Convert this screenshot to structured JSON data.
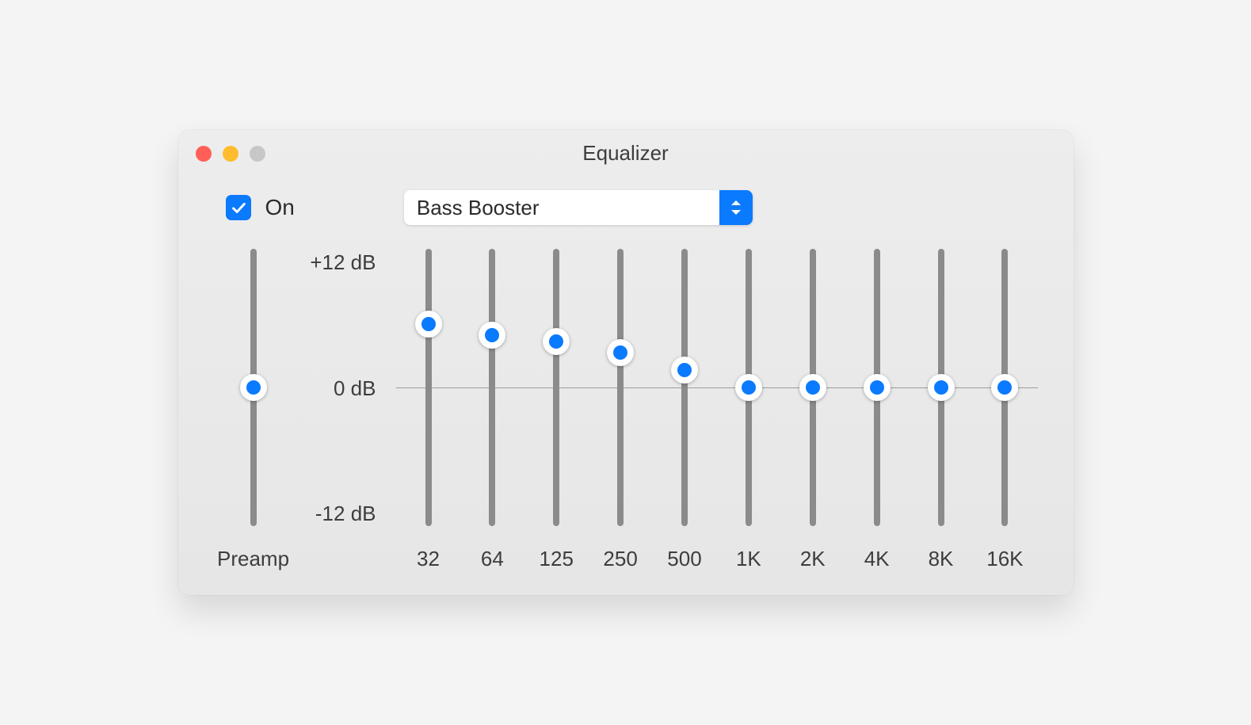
{
  "window": {
    "title": "Equalizer"
  },
  "controls": {
    "on_checked": true,
    "on_label": "On",
    "preset_value": "Bass Booster"
  },
  "scale": {
    "max": "+12 dB",
    "zero": "0 dB",
    "min": "-12 dB"
  },
  "preamp": {
    "label": "Preamp",
    "value_db": 0
  },
  "bands": [
    {
      "freq": "32",
      "value_db": 5.5
    },
    {
      "freq": "64",
      "value_db": 4.5
    },
    {
      "freq": "125",
      "value_db": 4.0
    },
    {
      "freq": "250",
      "value_db": 3.0
    },
    {
      "freq": "500",
      "value_db": 1.5
    },
    {
      "freq": "1K",
      "value_db": 0
    },
    {
      "freq": "2K",
      "value_db": 0
    },
    {
      "freq": "4K",
      "value_db": 0
    },
    {
      "freq": "8K",
      "value_db": 0
    },
    {
      "freq": "16K",
      "value_db": 0
    }
  ],
  "chart_data": {
    "type": "bar",
    "title": "Equalizer",
    "ylabel": "dB",
    "ylim": [
      -12,
      12
    ],
    "categories": [
      "Preamp",
      "32",
      "64",
      "125",
      "250",
      "500",
      "1K",
      "2K",
      "4K",
      "8K",
      "16K"
    ],
    "values": [
      0,
      5.5,
      4.5,
      4.0,
      3.0,
      1.5,
      0,
      0,
      0,
      0,
      0
    ]
  }
}
